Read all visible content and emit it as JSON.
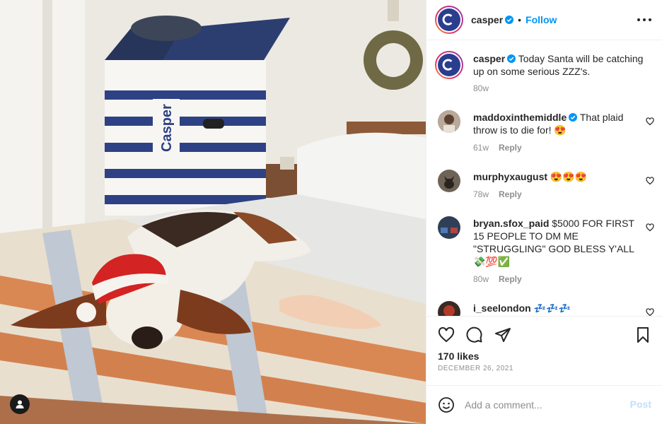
{
  "post": {
    "author": "casper",
    "follow_label": "Follow",
    "dot": "•",
    "caption": "Today Santa will be catching up on some serious ZZZ's.",
    "caption_age": "80w",
    "box_text": "Casper",
    "likes": "170 likes",
    "date": "DECEMBER 26, 2021"
  },
  "comments": [
    {
      "user": "maddoxinthemiddle",
      "verified": true,
      "text": "That plaid throw is to die for! 😍",
      "age": "61w",
      "reply": "Reply"
    },
    {
      "user": "murphyxaugust",
      "verified": false,
      "text": "😍😍😍",
      "age": "78w",
      "reply": "Reply"
    },
    {
      "user": "bryan.sfox_paid",
      "verified": false,
      "text": "$5000 FOR FIRST 15 PEOPLE TO DM ME \"STRUGGLING\" GOD BLESS Y'ALL 💸💯✅",
      "age": "80w",
      "reply": "Reply"
    },
    {
      "user": "i_seelondon",
      "verified": false,
      "text": "💤💤💤",
      "age": "",
      "reply": ""
    }
  ],
  "add_comment": {
    "placeholder": "Add a comment...",
    "post_label": "Post"
  },
  "icons": {
    "like": "heart-icon",
    "comment": "comment-icon",
    "share": "share-icon",
    "save": "bookmark-icon",
    "emoji": "smiley-icon",
    "tag": "user-tag-icon",
    "more": "more-options-icon",
    "verified": "verified-badge-icon"
  },
  "colors": {
    "link_blue": "#0095f6",
    "post_disabled": "#c0dffd",
    "brand_navy": "#2b3d8e",
    "muted": "#8e8e8e"
  }
}
